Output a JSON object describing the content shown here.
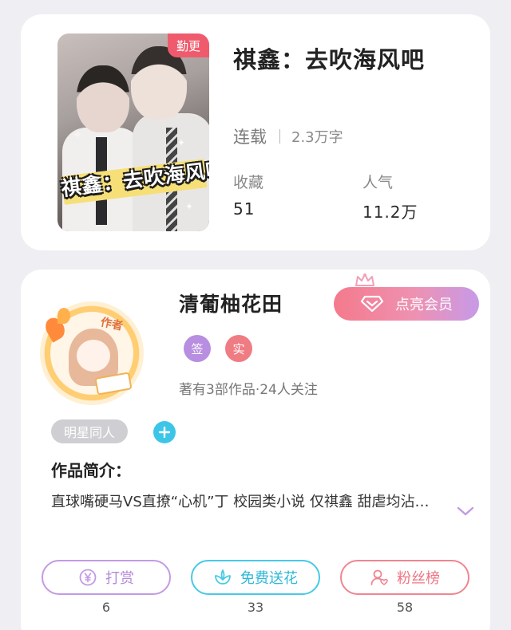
{
  "book": {
    "title": "祺鑫：去吹海风吧",
    "cover_title": "祺鑫：去吹海风吧",
    "ribbon": "勤更",
    "status": "连载",
    "word_count": "2.3万字",
    "stats": [
      {
        "label": "收藏",
        "value": "51"
      },
      {
        "label": "人气",
        "value": "11.2万"
      }
    ]
  },
  "author": {
    "name": "清葡柚花田",
    "avatar_badge": "作者",
    "vip_label": "点亮会员",
    "tags": [
      {
        "label": "签",
        "color": "#b88ee0"
      },
      {
        "label": "实",
        "color": "#f07c83"
      }
    ],
    "works_info": "著有3部作品·24人关注"
  },
  "genre_chip": "明星同人",
  "intro": {
    "heading": "作品简介：",
    "text": "直球嘴硬马VS直撩“心机”丁 校园类小说 仅祺鑫 甜虐均沾…"
  },
  "actions": [
    {
      "label": "打赏",
      "icon": "yen-coin-icon",
      "count": "6",
      "color": "#c39ae4"
    },
    {
      "label": "免费送花",
      "icon": "flower-icon",
      "count": "33",
      "color": "#48c9e6"
    },
    {
      "label": "粉丝榜",
      "icon": "fans-person-icon",
      "count": "58",
      "color": "#f08591"
    }
  ],
  "colors": {
    "background": "#efeff3",
    "ribbon": "#ef5b6c",
    "genre_chip": "#cfcfd3",
    "add_button": "#3dc5e8"
  }
}
